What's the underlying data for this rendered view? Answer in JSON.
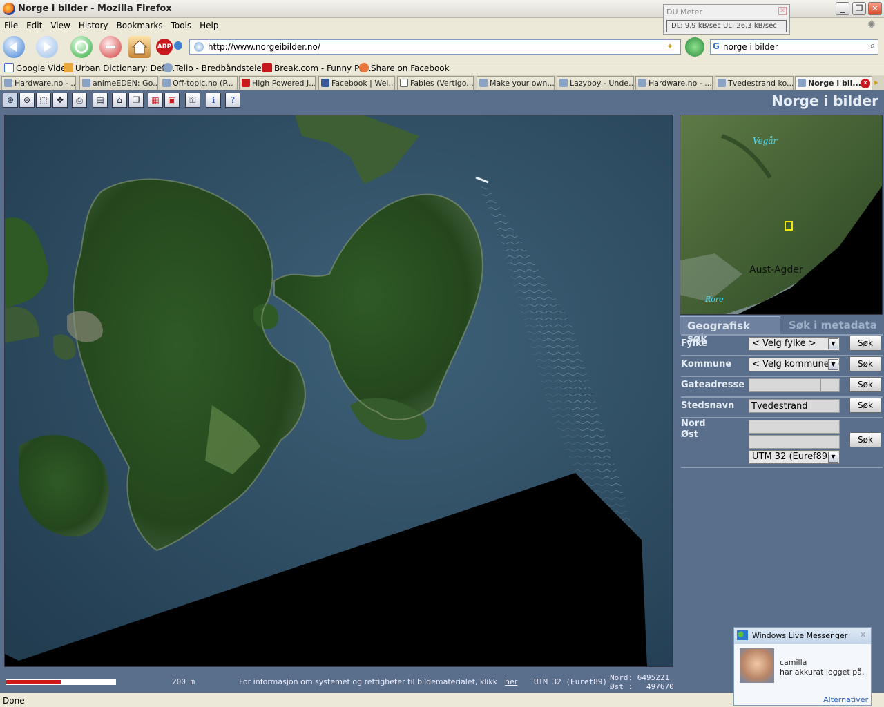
{
  "window": {
    "title": "Norge i bilder - Mozilla Firefox"
  },
  "menu": [
    "File",
    "Edit",
    "View",
    "History",
    "Bookmarks",
    "Tools",
    "Help"
  ],
  "du_meter": {
    "title": "DU Meter",
    "readout": "DL: 9,9 kB/sec  UL: 26,3 kB/sec"
  },
  "nav": {
    "url": "http://www.norgeibilder.no/",
    "search": "norge i bilder",
    "abp": "ABP"
  },
  "bookmarks": [
    "Google Video",
    "Urban Dictionary: Defi...",
    "Telio - Bredbåndstelef...",
    "Break.com - Funny Pic...",
    "Share on Facebook"
  ],
  "tabs": [
    "Hardware.no - ...",
    "animeEDEN: Go...",
    "Off-topic.no (P...",
    "High Powered J...",
    "Facebook | Wel...",
    "Fables (Vertigo...",
    "Make your own...",
    "Lazyboy - Unde...",
    "Hardware.no - ...",
    "Tvedestrand ko...",
    "Norge i bil..."
  ],
  "app": {
    "title": "Norge i bilder"
  },
  "overview": {
    "labels": {
      "vegar": "Vegår",
      "region": "Aust-Agder",
      "rore": "Rore"
    }
  },
  "panel": {
    "tab_geo": "Geografisk søk",
    "tab_meta": "Søk i metadata",
    "fylke_label": "Fylke",
    "fylke_value": "< Velg fylke >",
    "kommune_label": "Kommune",
    "kommune_value": "< Velg kommune >",
    "gate_label": "Gateadresse",
    "sted_label": "Stedsnavn",
    "sted_value": "Tvedestrand",
    "nord_label": "Nord",
    "ost_label": "Øst",
    "utm_value": "UTM 32 (Euref89)",
    "search_btn": "Søk"
  },
  "map_status": {
    "scale": "200 m",
    "info": "For informasjon om systemet og rettigheter til bildematerialet, klikk",
    "link": "her",
    "crs": "UTM 32 (Euref89)",
    "nord": "Nord: 6495221",
    "ost": "Øst :   497670"
  },
  "statusbar": {
    "text": "Done"
  },
  "messenger": {
    "title": "Windows Live Messenger",
    "name": "camilla",
    "msg": "har akkurat logget på.",
    "alt": "Alternativer"
  }
}
